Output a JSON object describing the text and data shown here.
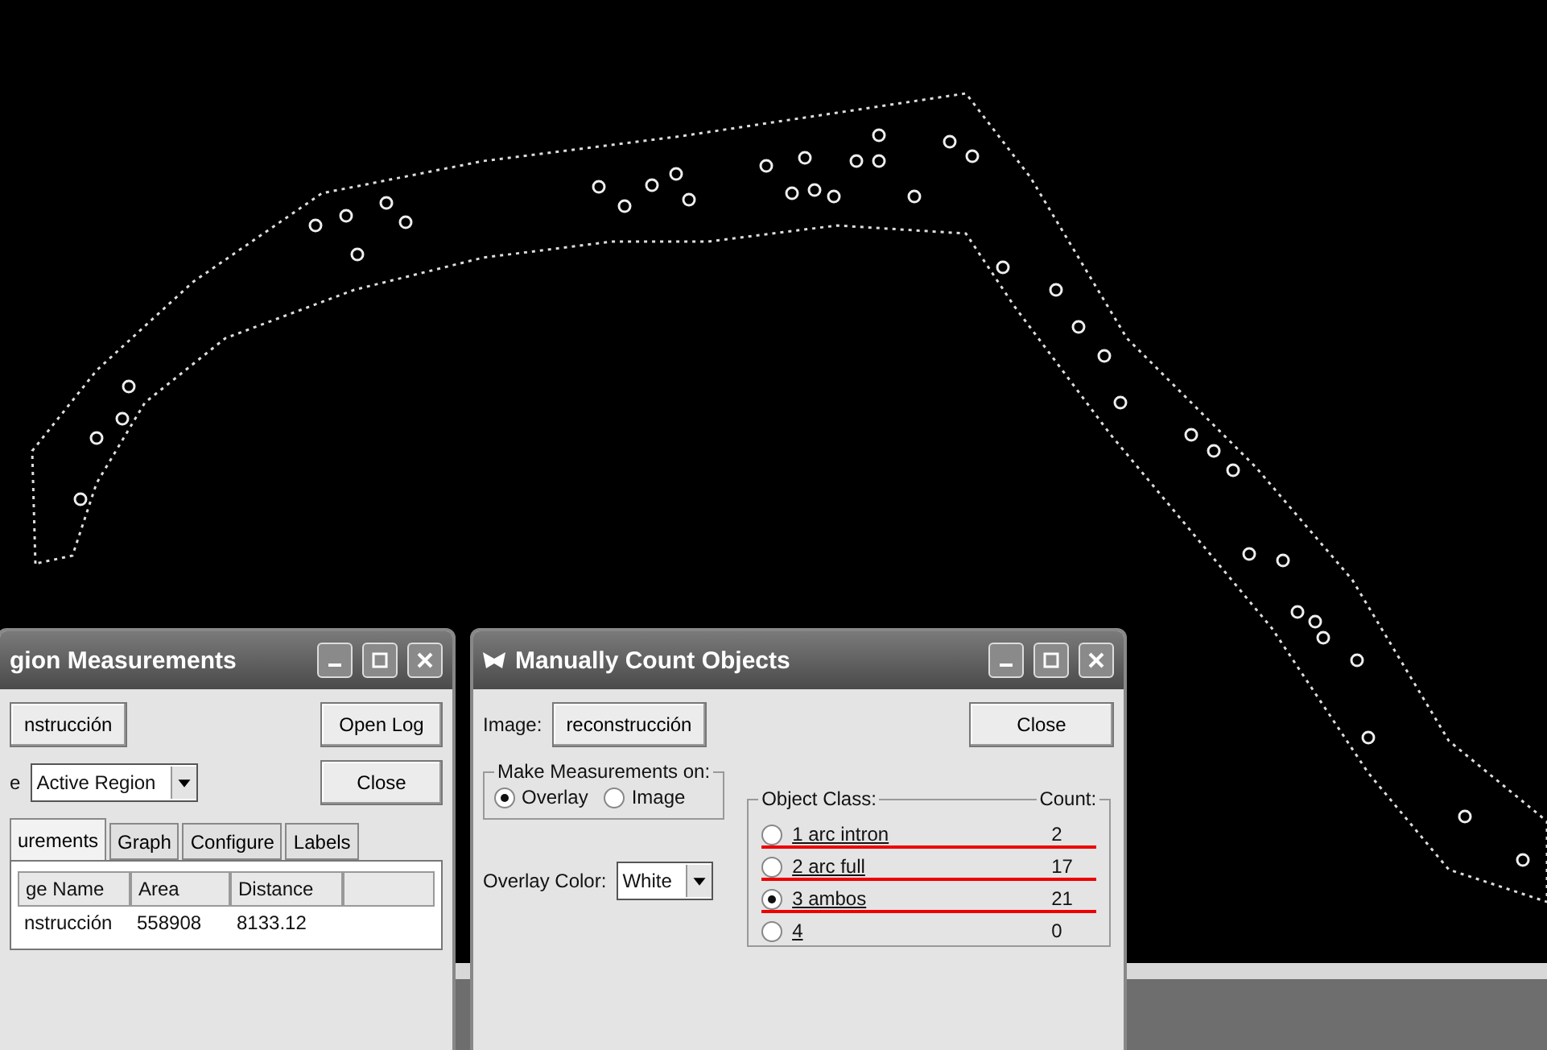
{
  "measure_window": {
    "title": "gion Measurements",
    "image_button": "nstrucción",
    "open_log": "Open Log",
    "source_label": "e",
    "source_value": "Active Region",
    "close": "Close",
    "tabs": [
      {
        "label": "urements",
        "selected": true
      },
      {
        "label": "Graph",
        "selected": false
      },
      {
        "label": "Configure",
        "selected": false
      },
      {
        "label": "Labels",
        "selected": false
      }
    ],
    "columns": [
      "ge Name",
      "Area",
      "Distance"
    ],
    "rows": [
      [
        "nstrucción",
        "558908",
        "8133.12"
      ]
    ]
  },
  "count_window": {
    "title": "Manually Count Objects",
    "image_label": "Image:",
    "image_button": "reconstrucción",
    "close": "Close",
    "measure_group": "Make Measurements on:",
    "targets": [
      {
        "label": "Overlay",
        "selected": true
      },
      {
        "label": "Image",
        "selected": false
      }
    ],
    "color_label": "Overlay Color:",
    "color_value": "White",
    "class_heading": "Object Class:",
    "count_heading": "Count:",
    "classes": [
      {
        "label": "1 arc intron",
        "count": "2",
        "selected": false,
        "underlined": true
      },
      {
        "label": "2 arc full",
        "count": "17",
        "selected": false,
        "underlined": true
      },
      {
        "label": "3 ambos",
        "count": "21",
        "selected": true,
        "underlined": true
      },
      {
        "label": "4",
        "count": "0",
        "selected": false,
        "underlined": false
      }
    ]
  }
}
